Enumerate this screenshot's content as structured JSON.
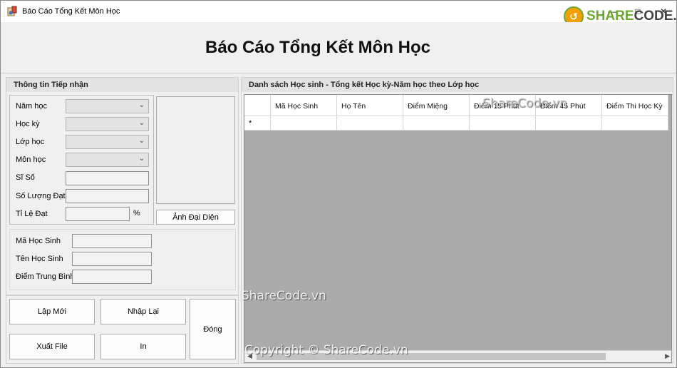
{
  "window": {
    "title": "Báo Cáo Tổng Kết Môn Học"
  },
  "header": {
    "title": "Báo Cáo Tổng Kết Môn Học"
  },
  "left_panel": {
    "title": "Thông tin Tiếp nhận",
    "fields": {
      "nam_hoc": "Năm học",
      "hoc_ky": "Học kỳ",
      "lop_hoc": "Lớp học",
      "mon_hoc": "Môn học",
      "si_so": "Sĩ Số",
      "so_luong_dat": "Số Lượng Đạt",
      "ti_le_dat": "Tỉ Lệ Đạt",
      "percent": "%"
    },
    "photo_button": "Ảnh Đại Diện",
    "student": {
      "ma_hoc_sinh": "Mã Học Sinh",
      "ten_hoc_sinh": "Tên Học Sinh",
      "diem_trung_binh": "Điểm Trung Bình"
    }
  },
  "buttons": {
    "lap_moi": "Lập Mới",
    "nhap_lai": "Nhập Lại",
    "xuat_file": "Xuất File",
    "in": "In",
    "dong": "Đóng"
  },
  "right_panel": {
    "title": "Danh sách Học sinh - Tổng kết Học kỳ-Năm học theo Lớp học",
    "columns": [
      "Mã Học Sinh",
      "Họ Tên",
      "Điểm Miệng",
      "Điểm 15 Phút",
      "Điểm 45 Phút",
      "Điểm Thi Học Kỳ"
    ],
    "new_row_marker": "*"
  },
  "watermark": {
    "logo_text_share": "SHARE",
    "logo_text_code": "CODE.vn",
    "grid_header": "ShareCode.vn",
    "center": "ShareCode.vn",
    "copyright": "Copyright © ShareCode.vn"
  },
  "colors": {
    "grid_bg": "#ababab",
    "logo_green": "#6da832",
    "logo_orange": "#f4a000"
  }
}
